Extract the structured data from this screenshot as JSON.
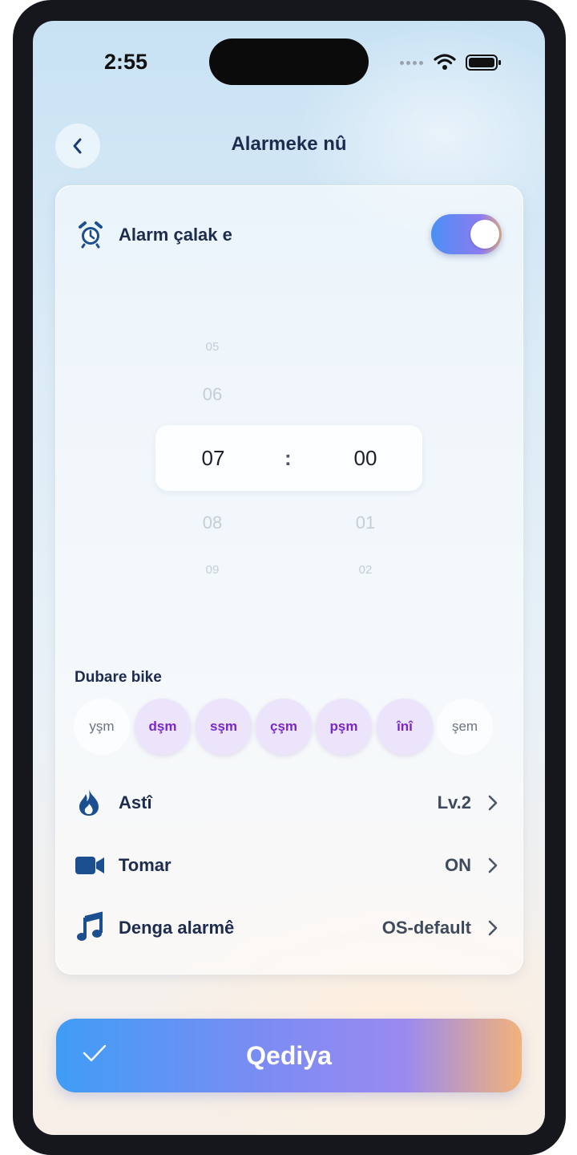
{
  "status_bar": {
    "time": "2:55"
  },
  "header": {
    "title": "Alarmeke nû",
    "back_icon": "chevron-left-icon"
  },
  "alarm": {
    "label": "Alarm çalak e",
    "enabled": true,
    "icon": "alarm-clock-icon"
  },
  "time_picker": {
    "hours_before": [
      "05",
      "06"
    ],
    "hour": "07",
    "hours_after": [
      "08",
      "09"
    ],
    "separator": ":",
    "minute": "00",
    "minutes_after": [
      "01",
      "02"
    ]
  },
  "repeat": {
    "label": "Dubare bike",
    "days": [
      {
        "label": "yşm",
        "selected": false
      },
      {
        "label": "dşm",
        "selected": true
      },
      {
        "label": "sşm",
        "selected": true
      },
      {
        "label": "çşm",
        "selected": true
      },
      {
        "label": "pşm",
        "selected": true
      },
      {
        "label": "înî",
        "selected": true
      },
      {
        "label": "şem",
        "selected": false
      }
    ]
  },
  "settings": [
    {
      "label": "Astî",
      "value": "Lv.2",
      "icon": "flame-icon"
    },
    {
      "label": "Tomar",
      "value": "ON",
      "icon": "video-camera-icon"
    },
    {
      "label": "Denga alarmê",
      "value": "OS-default",
      "icon": "music-note-icon"
    }
  ],
  "done_button": {
    "label": "Qediya",
    "icon": "checkmark-icon"
  },
  "colors": {
    "accent_purple": "#7a27c9",
    "title_navy": "#1d2b4f",
    "icon_blue": "#1b4f8f",
    "button_gradient_start": "#3f9df6",
    "button_gradient_end": "#f3b27a"
  }
}
